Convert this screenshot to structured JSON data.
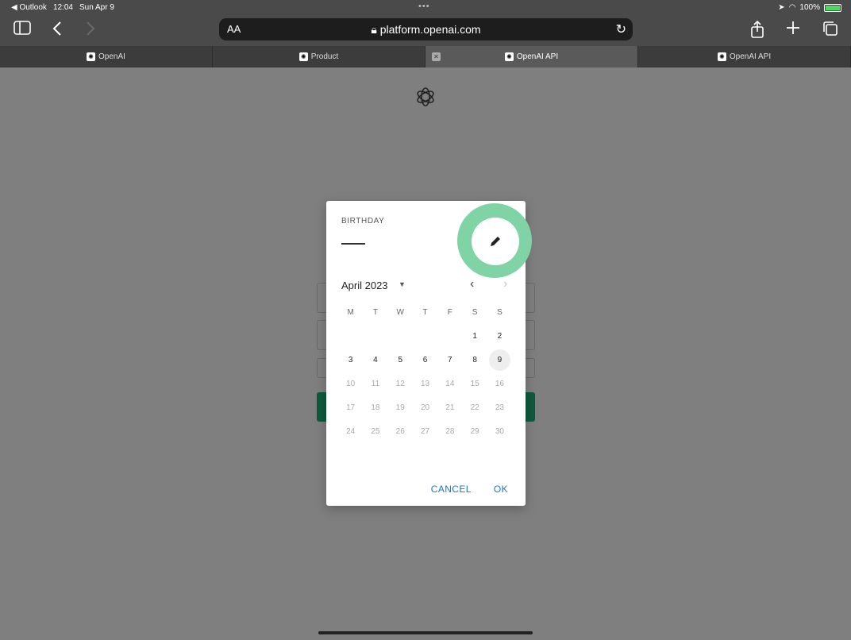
{
  "status_bar": {
    "back_app": "◀ Outlook",
    "time": "12:04",
    "date": "Sun Apr 9",
    "battery": "100%"
  },
  "toolbar": {
    "url_aa": "AA",
    "url": "platform.openai.com"
  },
  "tabs": [
    {
      "label": "OpenAI"
    },
    {
      "label": "Product"
    },
    {
      "label": "OpenAI API"
    },
    {
      "label": "OpenAI API"
    }
  ],
  "dialog": {
    "label": "BIRTHDAY",
    "month_label": "April 2023",
    "weekdays": [
      "M",
      "T",
      "W",
      "T",
      "F",
      "S",
      "S"
    ],
    "weeks": [
      [
        "",
        "",
        "",
        "",
        "",
        "1",
        "2"
      ],
      [
        "3",
        "4",
        "5",
        "6",
        "7",
        "8",
        "9"
      ],
      [
        "10",
        "11",
        "12",
        "13",
        "14",
        "15",
        "16"
      ],
      [
        "17",
        "18",
        "19",
        "20",
        "21",
        "22",
        "23"
      ],
      [
        "24",
        "25",
        "26",
        "27",
        "28",
        "29",
        "30"
      ]
    ],
    "today": "9",
    "last_selectable": 9,
    "cancel_label": "CANCEL",
    "ok_label": "OK"
  },
  "colors": {
    "accent": "#1976d2",
    "highlight_ring": "#7fd3a5",
    "primary_button": "#0e5a3c"
  }
}
